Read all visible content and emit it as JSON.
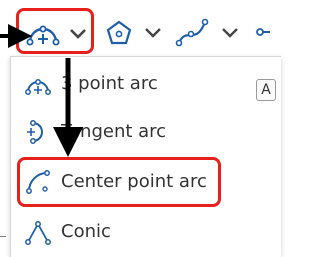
{
  "toolbar": {
    "buttons": [
      {
        "name": "3-point-arc-tool",
        "icon": "three-point-arc-icon"
      },
      {
        "name": "polygon-tool",
        "icon": "polygon-icon"
      },
      {
        "name": "spline-tool",
        "icon": "spline-icon"
      }
    ]
  },
  "menu": {
    "items": [
      {
        "label": "3 point arc",
        "icon": "three-point-arc-icon",
        "shortcut": "A"
      },
      {
        "label": "Tangent arc",
        "icon": "tangent-arc-icon"
      },
      {
        "label": "Center point arc",
        "icon": "center-point-arc-icon"
      },
      {
        "label": "Conic",
        "icon": "conic-icon"
      }
    ]
  },
  "colors": {
    "icon_blue": "#1f5fa8",
    "highlight_red": "#e8201c",
    "arrow_black": "#000000",
    "text": "#333333"
  }
}
